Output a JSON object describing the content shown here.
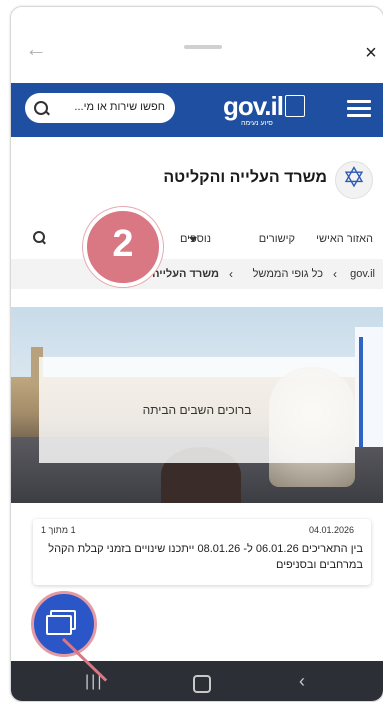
{
  "sheet": {
    "back_icon": "arrow-left-icon",
    "close_icon": "close-icon"
  },
  "gov_header": {
    "search_placeholder": "חפשו שירות או מי...",
    "logo_text": "gov.il",
    "logo_sub": "סיוע נעימה",
    "background": "#1f4fa0"
  },
  "ministry": {
    "title": "משרד העלייה והקליטה"
  },
  "nav": {
    "personal_area": "האזור האישי",
    "links": "קישורים",
    "more": "נוספים"
  },
  "step_badge": {
    "number": "2"
  },
  "breadcrumb": [
    "gov.il",
    "כל גופי הממשל",
    "משרד העלייה והקליטה"
  ],
  "hero": {
    "banner_text": "ברוכים השבים הביתה"
  },
  "update_card": {
    "date": "04.01.2026",
    "source": "1 מתוך 1",
    "text": "בין התאריכים 06.01.26 ל- 08.01.26 ייתכנו שינויים בזמני קבלת הקהל במרחבים ובסניפים"
  },
  "colors": {
    "accent": "#2b56c8",
    "badge": "#d97783"
  }
}
